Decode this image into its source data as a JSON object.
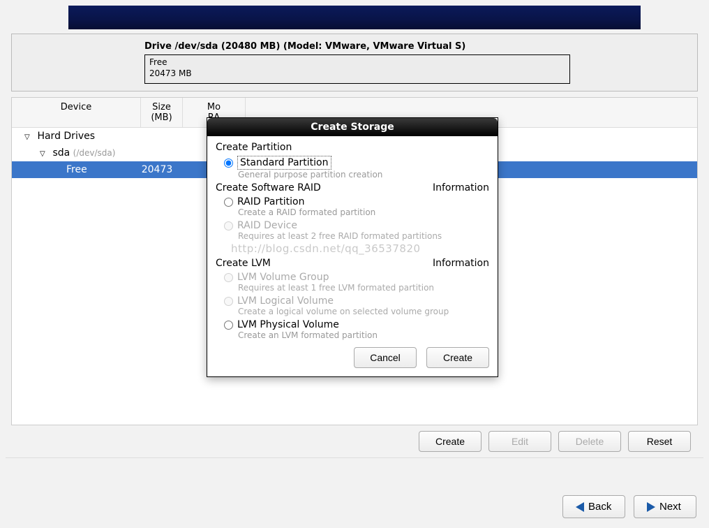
{
  "drive": {
    "title": "Drive /dev/sda (20480 MB) (Model: VMware, VMware Virtual S)",
    "segment_label_line1": "Free",
    "segment_label_line2": "20473 MB"
  },
  "columns": {
    "device": "Device",
    "size_line1": "Size",
    "size_line2": "(MB)",
    "mount_line1": "Mo",
    "mount_line2": "RA"
  },
  "tree": {
    "root": "Hard Drives",
    "sda_label": "sda",
    "sda_path": "(/dev/sda)",
    "free_label": "Free",
    "free_size": "20473"
  },
  "buttons": {
    "create": "Create",
    "edit": "Edit",
    "delete": "Delete",
    "reset": "Reset",
    "back": "Back",
    "next": "Next",
    "cancel": "Cancel",
    "dlg_create": "Create"
  },
  "dialog": {
    "title": "Create Storage",
    "sect_partition": "Create Partition",
    "opt_standard": "Standard Partition",
    "desc_standard": "General purpose partition creation",
    "sect_raid": "Create Software RAID",
    "info": "Information",
    "opt_raid_partition": "RAID Partition",
    "desc_raid_partition": "Create a RAID formated partition",
    "opt_raid_device": "RAID Device",
    "desc_raid_device": "Requires at least 2 free RAID formated partitions",
    "sect_lvm": "Create LVM",
    "opt_lvm_vg": "LVM Volume Group",
    "desc_lvm_vg": "Requires at least 1 free LVM formated partition",
    "opt_lvm_lv": "LVM Logical Volume",
    "desc_lvm_lv": "Create a logical volume on selected volume group",
    "opt_lvm_pv": "LVM Physical Volume",
    "desc_lvm_pv": "Create an LVM formated partition"
  },
  "watermark": "http://blog.csdn.net/qq_36537820"
}
